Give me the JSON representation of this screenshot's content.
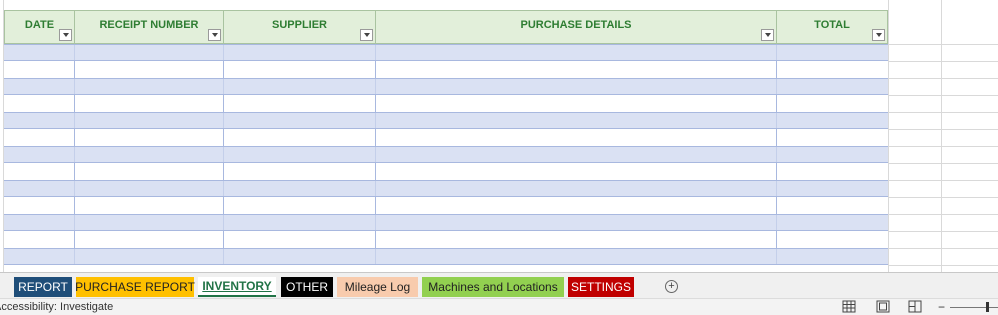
{
  "table": {
    "headers": [
      {
        "label": "DATE"
      },
      {
        "label": "RECEIPT NUMBER"
      },
      {
        "label": "SUPPLIER"
      },
      {
        "label": "PURCHASE DETAILS"
      },
      {
        "label": "TOTAL"
      }
    ],
    "row_count": 13
  },
  "sheet_tabs": [
    {
      "label": "REPORT",
      "bg": "#1f4e79",
      "color": "#ffffff"
    },
    {
      "label": "PURCHASE REPORT",
      "bg": "#ffc000",
      "color": "#222222"
    },
    {
      "label": "INVENTORY",
      "active": true,
      "color": "#217346"
    },
    {
      "label": "OTHER",
      "bg": "#000000",
      "color": "#ffffff"
    },
    {
      "label": "Mileage Log",
      "bg": "#f8cbad",
      "color": "#222222"
    },
    {
      "label": "Machines and Locations",
      "bg": "#92d050",
      "color": "#222222"
    },
    {
      "label": "SETTINGS",
      "bg": "#c00000",
      "color": "#ffffff"
    }
  ],
  "add_sheet_icon": "plus-circle-icon",
  "status_bar": {
    "accessibility_text": "Accessibility: Investigate"
  },
  "colors": {
    "header_bg": "#e2efda",
    "header_text": "#2e7d32",
    "band_row": "#dae1f3"
  }
}
